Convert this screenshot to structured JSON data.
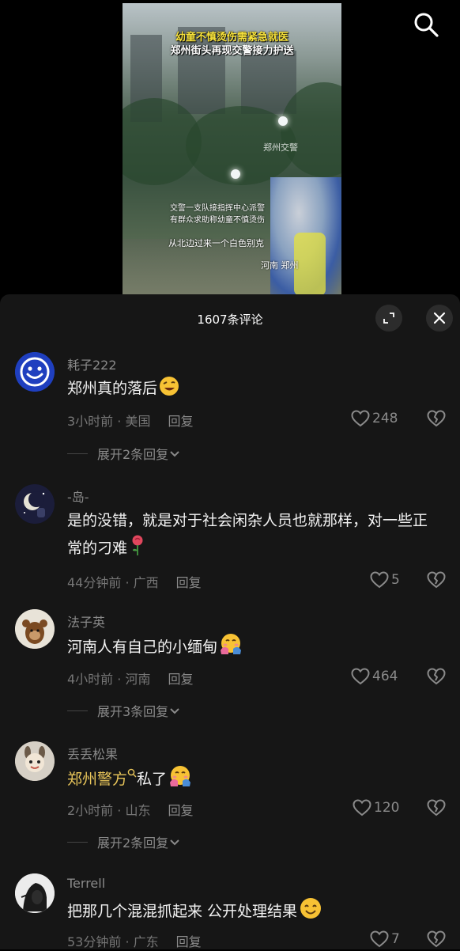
{
  "video": {
    "title_line1": "幼童不慎烫伤需紧急就医",
    "title_line2": "郑州街头再现交警接力护送",
    "watermark": "郑州交警",
    "subtitle_line1": "交警一支队接指挥中心派警",
    "subtitle_line2": "有群众求助称幼童不慎烫伤",
    "subtitle_line3": "从北边过来一个白色别克",
    "location": "河南 郑州"
  },
  "comments_panel": {
    "title": "1607条评论",
    "comments": [
      {
        "username": "耗子222",
        "text": "郑州真的落后",
        "emoji": "grinning-wink-emoji",
        "time": "3小时前",
        "location": "美国",
        "reply_label": "回复",
        "likes": "248",
        "expand_label": "展开2条回复"
      },
      {
        "username": "-岛-",
        "text": "是的没错，就是对于社会闲杂人员也就那样，对一些正常的刁难",
        "emoji": "rose-emoji",
        "time": "44分钟前",
        "location": "广西",
        "reply_label": "回复",
        "likes": "5"
      },
      {
        "username": "法子英",
        "text": "河南人有自己的小缅甸",
        "emoji": "hug-emoji",
        "time": "4小时前",
        "location": "河南",
        "reply_label": "回复",
        "likes": "464",
        "expand_label": "展开3条回复"
      },
      {
        "username": "丢丢松果",
        "mention": "郑州警方",
        "text": "私了",
        "emoji": "hug-emoji",
        "time": "2小时前",
        "location": "山东",
        "reply_label": "回复",
        "likes": "120",
        "expand_label": "展开2条回复"
      },
      {
        "username": "Terrell",
        "text": "把那几个混混抓起来 公开处理结果",
        "emoji": "smile-emoji",
        "time": "53分钟前",
        "location": "广东",
        "reply_label": "回复",
        "likes": "7"
      }
    ]
  },
  "colors": {
    "sheet_bg": "#161616",
    "mention": "#e8c55a",
    "meta_text": "#767676"
  }
}
